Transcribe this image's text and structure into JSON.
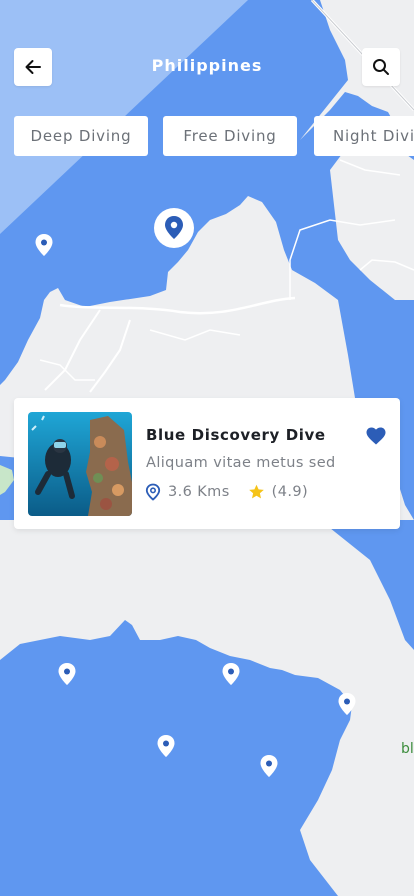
{
  "header": {
    "title": "Philippines",
    "back_icon": "arrow-left-icon",
    "search_icon": "search-icon"
  },
  "filters": {
    "chips": [
      {
        "label": "Deep Diving"
      },
      {
        "label": "Free Diving"
      },
      {
        "label": "Night Diving"
      }
    ]
  },
  "map": {
    "water_color": "#5F97F0",
    "land_color": "#EEEFF1",
    "pin_icon": "map-pin-icon",
    "edge_label": "bl"
  },
  "card": {
    "title": "Blue Discovery Dive",
    "subtitle": "Aliquam vitae metus sed",
    "distance": "3.6 Kms",
    "rating": "(4.9)",
    "distance_icon": "location-pin-icon",
    "rating_icon": "star-icon",
    "favorite_icon": "heart-icon"
  },
  "colors": {
    "accent": "#2C5DB7",
    "star": "#F5C318"
  }
}
